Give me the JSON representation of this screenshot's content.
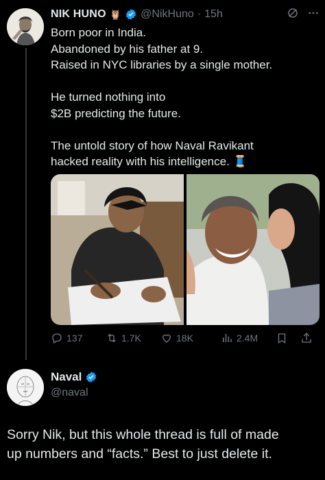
{
  "tweet": {
    "author_name": "NIK HUNO",
    "author_emoji": "🦉",
    "handle": "@NikHuno",
    "separator": "·",
    "time": "15h",
    "lines": [
      "Born poor in India.",
      "Abandoned by his father at 9.",
      "Raised in NYC libraries by a single mother.",
      "He turned nothing into",
      "$2B predicting the future.",
      "The untold story of how Naval Ravikant",
      "hacked reality with his intelligence. 🧵"
    ],
    "stats": {
      "replies": "137",
      "retweets": "1.7K",
      "likes": "18K",
      "views": "2.4M"
    }
  },
  "reply": {
    "author_name": "Naval",
    "handle": "@naval",
    "text_lines": [
      "Sorry Nik, but this whole thread is full of made",
      "up numbers and “facts.” Best to just delete it."
    ]
  },
  "colors": {
    "background": "#000000",
    "text": "#e7e9ea",
    "muted": "#71767b",
    "verified": "#1d9bf0"
  }
}
